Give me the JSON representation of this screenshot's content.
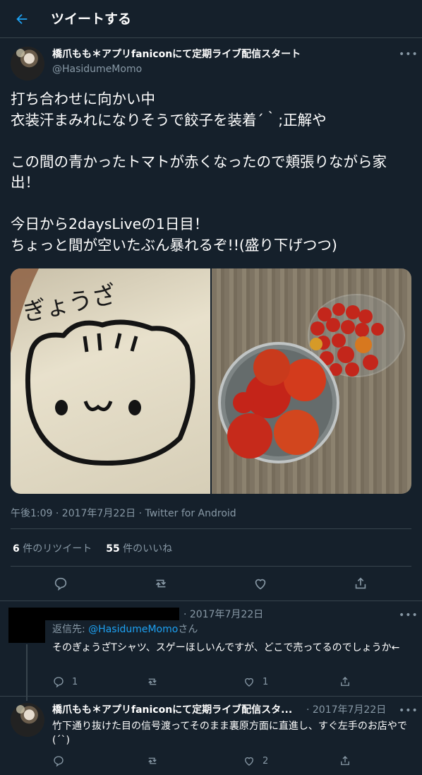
{
  "header": {
    "title": "ツイートする"
  },
  "tweet": {
    "name": "橋爪もも＊アプリfaniconにて定期ライブ配信スタート",
    "handle": "@HasidumeMomo",
    "text": "打ち合わせに向かい中\n衣装汗まみれになりそうで餃子を装着´｀;正解や\n\nこの間の青かったトマトが赤くなったので頬張りながら家出！\n\n今日から2daysLiveの1日目！\nちょっと間が空いたぶん暴れるぞ!!(盛り下げつつ)",
    "shirt_text": "ぎょうざ",
    "timestamp": "午後1:09 · 2017年7月22日 · Twitter for Android",
    "retweets_count": "6",
    "retweets_label": "件のリツイート",
    "likes_count": "55",
    "likes_label": "件のいいね"
  },
  "reply1": {
    "date": "· 2017年7月22日",
    "replying_to_label": "返信先:",
    "replying_to_handle": "@HasidumeMomo",
    "replying_to_suffix": "さん",
    "text": "そのぎょうざTシャツ、スゲーほしいんですが、どこで売ってるのでしょうか←",
    "reply_count": "1",
    "like_count": "1"
  },
  "reply2": {
    "name": "橋爪もも＊アプリfaniconにて定期ライブ配信スタ...",
    "date": "· 2017年7月22日",
    "text": "竹下通り抜けた目の信号渡ってそのまま裏原方面に直進し、すぐ左手のお店やで(´`)",
    "like_count": "2"
  },
  "colors": {
    "background": "#15202b",
    "accent": "#1da1f2",
    "muted": "#8899a6",
    "border": "#38444d"
  },
  "icons": [
    "back-arrow-icon",
    "more-icon",
    "reply-icon",
    "retweet-icon",
    "like-icon",
    "share-icon"
  ]
}
